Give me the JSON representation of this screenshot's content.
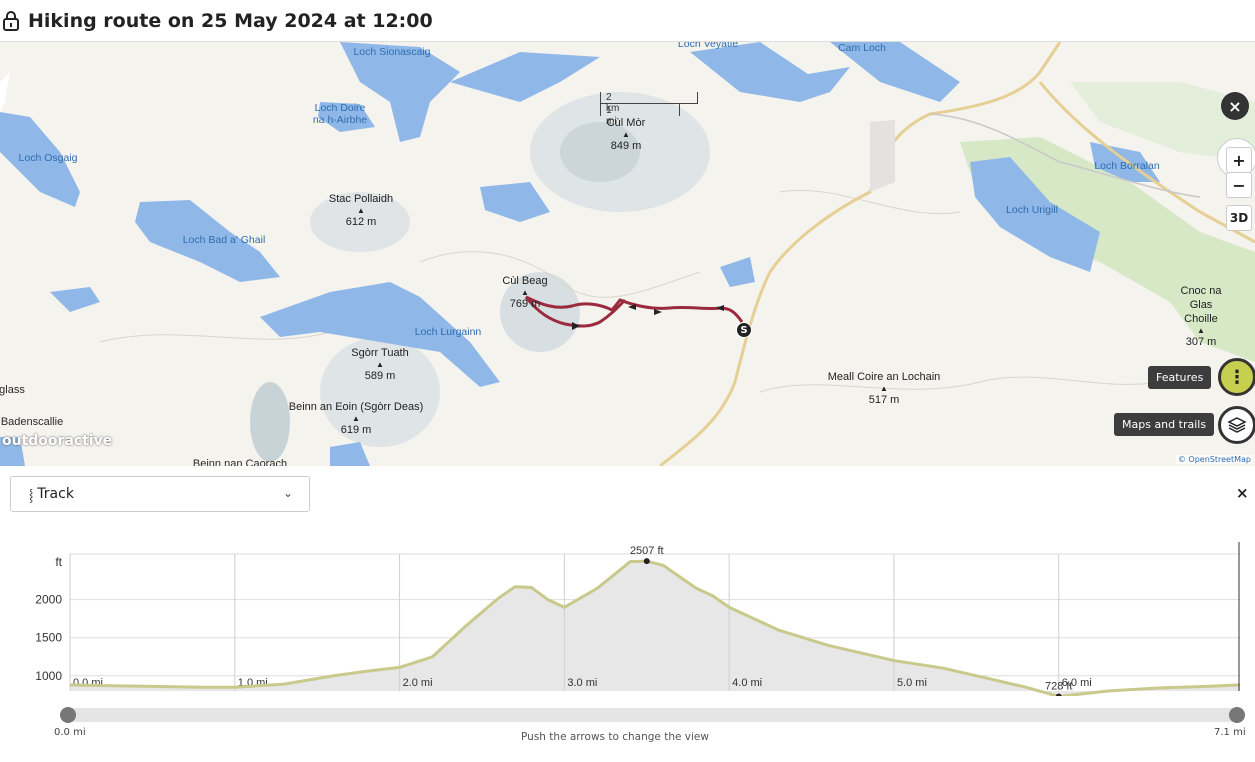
{
  "header": {
    "title": "Hiking route on 25 May 2024 at 12:00"
  },
  "map": {
    "scale": {
      "km": "2 km",
      "mi": "1 mi"
    },
    "peaks": [
      {
        "name": "Cùl Mòr",
        "elev": "849 m"
      },
      {
        "name": "Stac Pollaidh",
        "elev": "612 m"
      },
      {
        "name": "Cùl Beag",
        "elev": "769 m"
      },
      {
        "name": "Sgòrr Tuath",
        "elev": "589 m"
      },
      {
        "name": "Beinn an Eoin (Sgòrr Deas)",
        "elev": "619 m"
      },
      {
        "name": "Meall Coire an Lochain",
        "elev": "517 m"
      },
      {
        "name": "Cnoc na Glas Choille",
        "elev": "307 m"
      }
    ],
    "water": [
      "Loch Sionascaig",
      "Loch Veyatie",
      "Cam Loch",
      "Loch Doire na h-Airbhe",
      "Loch Osgaig",
      "Loch Bad a' Ghail",
      "Loch Lurgainn",
      "Loch Borralan",
      "Loch Urigill"
    ],
    "places": [
      "glass",
      "Badenscallie",
      "Beinn nan Caorach"
    ],
    "watermark": "outdooractive",
    "attribution": "© OpenStreetMap",
    "compass_label": "N",
    "zoom_in": "+",
    "zoom_out": "−",
    "btn_3d": "3D",
    "features_label": "Features",
    "maps_label": "Maps and trails",
    "start_marker": "S",
    "close_icon": "×"
  },
  "panel": {
    "select_value": "Track",
    "close_icon": "×",
    "slider_min": "0.0 mi",
    "slider_max": "7.1 mi",
    "hint": "Push the arrows to change the view"
  },
  "chart_data": {
    "type": "area",
    "ylabel": "ft",
    "xlabel": "",
    "xlim": [
      0,
      7.1
    ],
    "ylim": [
      800,
      2600
    ],
    "yticks": [
      1000,
      1500,
      2000
    ],
    "xticks": [
      "0.0 mi",
      "1.0 mi",
      "2.0 mi",
      "3.0 mi",
      "4.0 mi",
      "5.0 mi",
      "6.0 mi"
    ],
    "x": [
      0,
      0.2,
      0.5,
      0.8,
      1.0,
      1.3,
      1.6,
      1.8,
      2.0,
      2.2,
      2.4,
      2.6,
      2.7,
      2.8,
      2.9,
      3.0,
      3.2,
      3.4,
      3.5,
      3.6,
      3.8,
      3.9,
      4.0,
      4.3,
      4.6,
      5.0,
      5.3,
      5.6,
      5.8,
      6.0,
      6.3,
      6.6,
      6.9,
      7.1
    ],
    "y": [
      880,
      870,
      860,
      850,
      850,
      890,
      1000,
      1060,
      1110,
      1250,
      1650,
      2020,
      2170,
      2160,
      2000,
      1900,
      2150,
      2500,
      2507,
      2450,
      2150,
      2050,
      1900,
      1600,
      1400,
      1200,
      1100,
      950,
      850,
      728,
      800,
      840,
      860,
      880
    ],
    "annotations": [
      {
        "x": 3.5,
        "y": 2507,
        "label": "2507 ft"
      },
      {
        "x": 6.0,
        "y": 728,
        "label": "728 ft"
      }
    ],
    "grid": true
  }
}
